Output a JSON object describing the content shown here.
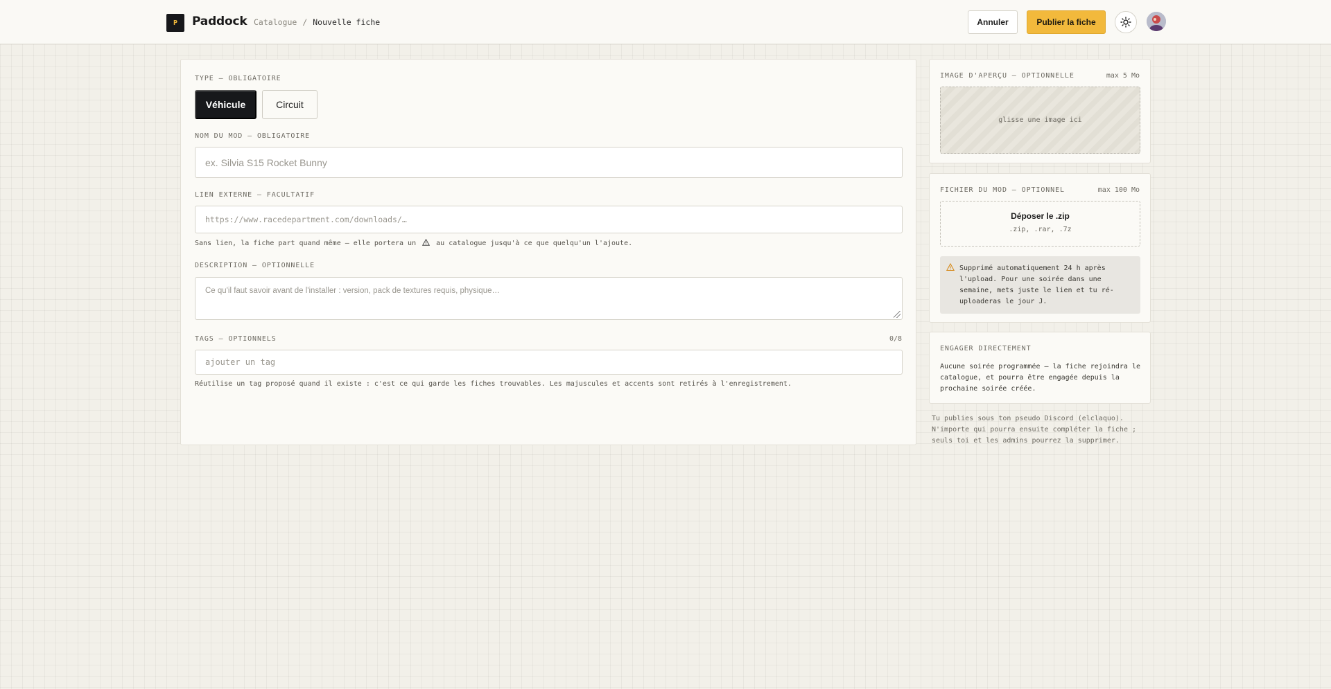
{
  "header": {
    "logo_letter": "P",
    "brand": "Paddock",
    "breadcrumb": {
      "parent": "Catalogue",
      "separator": "/",
      "current": "Nouvelle fiche"
    },
    "cancel_label": "Annuler",
    "publish_label": "Publier la fiche",
    "theme_icon": "sun-icon",
    "avatar": "user-avatar"
  },
  "form": {
    "type": {
      "label": "TYPE — OBLIGATOIRE",
      "options": [
        "Véhicule",
        "Circuit"
      ],
      "selected": "Véhicule"
    },
    "name": {
      "label": "NOM DU MOD — OBLIGATOIRE",
      "value": "",
      "placeholder": "ex. Silvia S15 Rocket Bunny"
    },
    "link": {
      "label": "LIEN EXTERNE — FACULTATIF",
      "value": "",
      "placeholder": "https://www.racedepartment.com/downloads/…",
      "hint_before": "Sans lien, la fiche part quand même — elle portera un",
      "hint_after": "au catalogue jusqu'à ce que quelqu'un l'ajoute."
    },
    "description": {
      "label": "DESCRIPTION — OPTIONNELLE",
      "value": "",
      "placeholder": "Ce qu'il faut savoir avant de l'installer : version, pack de textures requis, physique…"
    },
    "tags": {
      "label": "TAGS — OPTIONNELS",
      "count": "0/8",
      "value": "",
      "placeholder": "ajouter un tag",
      "hint": "Réutilise un tag proposé quand il existe : c'est ce qui garde les fiches trouvables. Les majuscules et accents sont retirés à l'enregistrement."
    }
  },
  "sidebar": {
    "preview": {
      "label": "IMAGE D'APERÇU — OPTIONNELLE",
      "max": "max 5 Mo",
      "drop_text": "glisse une image ici"
    },
    "file": {
      "label": "FICHIER DU MOD — OPTIONNEL",
      "max": "max 100 Mo",
      "drop_title": "Déposer le .zip",
      "extensions": ".zip, .rar, .7z",
      "warning": "Supprimé automatiquement 24 h après l'upload. Pour une soirée dans une semaine, mets juste le lien et tu ré-uploaderas le jour J."
    },
    "engage": {
      "label": "ENGAGER DIRECTEMENT",
      "text": "Aucune soirée programmée — la fiche rejoindra le catalogue, et pourra être engagée depuis la prochaine soirée créée."
    },
    "footnote": "Tu publies sous ton pseudo Discord (elclaquo). N'importe qui pourra ensuite compléter la fiche ; seuls toi et les admins pourrez la supprimer."
  },
  "colors": {
    "accent": "#f2b93c",
    "dark": "#17181b",
    "background": "#f2f0e9"
  }
}
